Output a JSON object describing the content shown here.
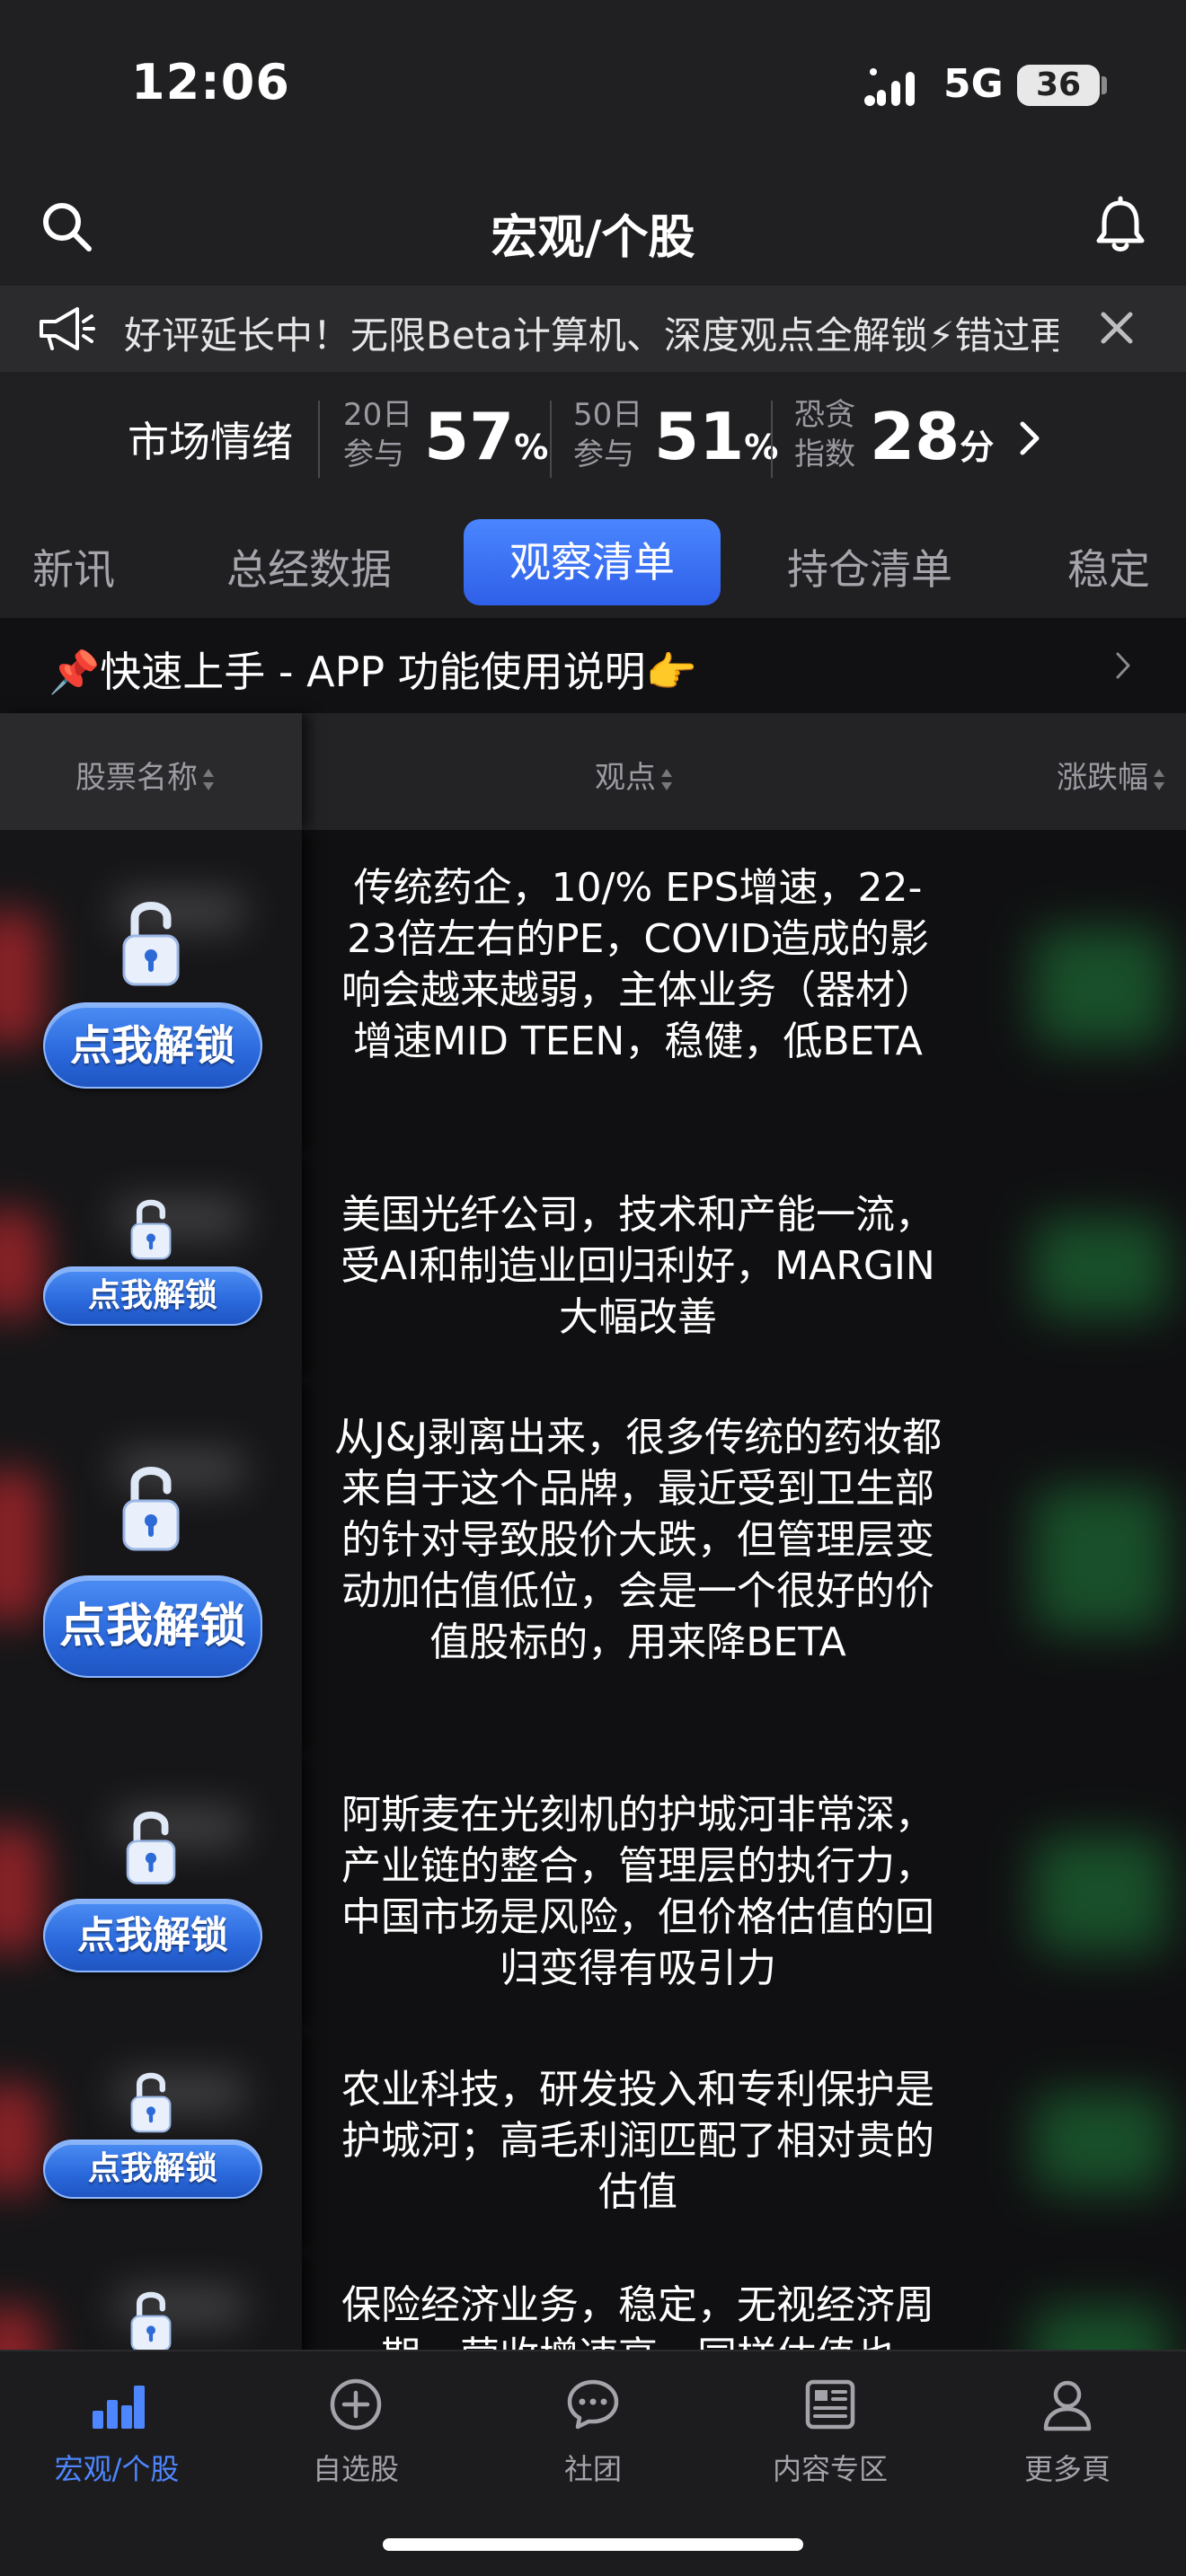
{
  "status_bar": {
    "time": "12:06",
    "network": "5G",
    "battery": "36"
  },
  "header": {
    "title": "宏观/个股"
  },
  "notice": {
    "text": "好评延长中！无限Beta计算机、深度观点全解锁⚡错过再等一年"
  },
  "sentiment": {
    "label": "市场情绪",
    "m20": {
      "line1": "20日",
      "line2": "参与",
      "value": "57",
      "unit": "%"
    },
    "m50": {
      "line1": "50日",
      "line2": "参与",
      "value": "51",
      "unit": "%"
    },
    "fear": {
      "line1": "恐贪",
      "line2": "指数",
      "value": "28",
      "unit": "分"
    }
  },
  "tabs": [
    {
      "label": "新讯"
    },
    {
      "label": "总经数据"
    },
    {
      "label": "观察清单",
      "active": true
    },
    {
      "label": "持仓清单"
    },
    {
      "label": "稳定"
    }
  ],
  "guide": {
    "text": "📌快速上手 - APP 功能使用说明👉"
  },
  "table": {
    "columns": [
      "股票名称",
      "观点",
      "涨跌幅"
    ],
    "unlock_label": "点我解锁",
    "rows": [
      {
        "view": "传统药企，10/% EPS增速，22-23倍左右的PE，COVID造成的影响会越来越弱，主体业务（器材）增速MID TEEN，稳健，低BETA"
      },
      {
        "view": "美国光纤公司，技术和产能一流，受AI和制造业回归利好，MARGIN大幅改善"
      },
      {
        "view": "从J&J剥离出来，很多传统的药妆都来自于这个品牌，最近受到卫生部的针对导致股价大跌，但管理层变动加估值低位，会是一个很好的价值股标的，用来降BETA"
      },
      {
        "view": "阿斯麦在光刻机的护城河非常深，产业链的整合，管理层的执行力，中国市场是风险，但价格估值的回归变得有吸引力"
      },
      {
        "view": "农业科技，研发投入和专利保护是护城河；高毛利润匹配了相对贵的估值"
      },
      {
        "view": "保险经济业务，稳定，无视经济周期，营收增速高，同样估值也"
      }
    ]
  },
  "bottom_nav": [
    {
      "label": "宏观/个股",
      "icon": "bar-chart-icon",
      "active": true
    },
    {
      "label": "自选股",
      "icon": "plus-circle-icon"
    },
    {
      "label": "社团",
      "icon": "chat-bubble-icon"
    },
    {
      "label": "内容专区",
      "icon": "newspaper-icon"
    },
    {
      "label": "更多頁",
      "icon": "person-icon"
    }
  ],
  "colors": {
    "accent": "#4a86ff",
    "background": "#141416",
    "unlock_button": "#2a68dc"
  }
}
